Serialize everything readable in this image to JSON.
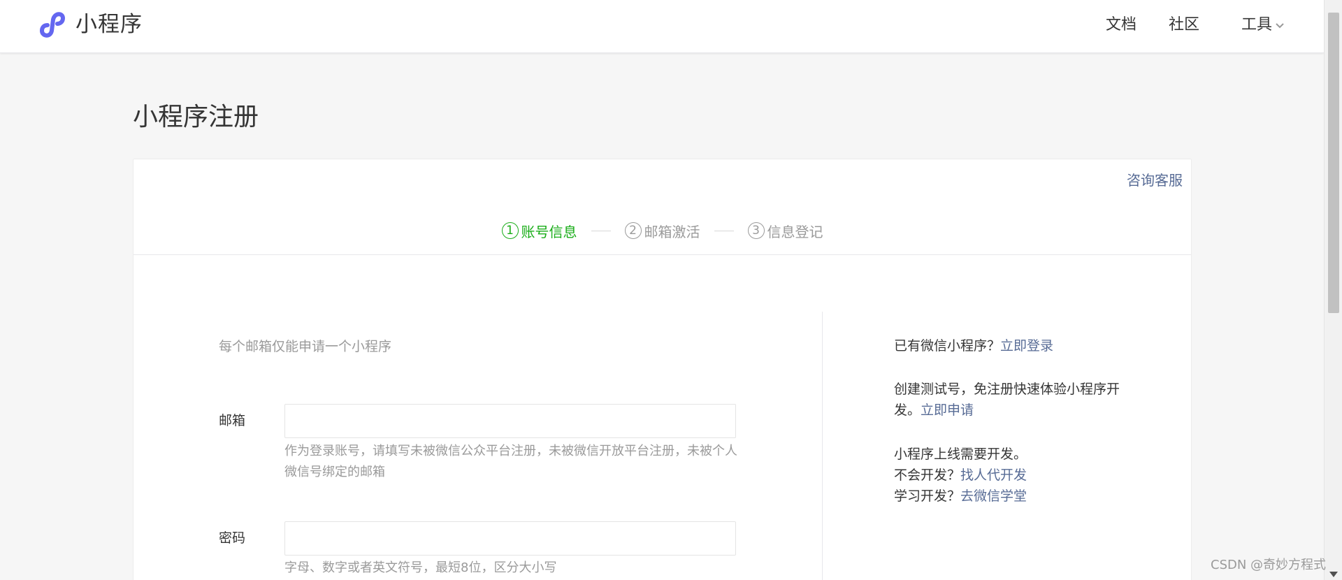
{
  "header": {
    "brand": "小程序",
    "nav": {
      "docs": "文档",
      "community": "社区",
      "tools": "工具"
    },
    "logo_icon": "mini-program-logo-icon",
    "logo_color": "#6467f0"
  },
  "page": {
    "title": "小程序注册"
  },
  "card": {
    "consult": "咨询客服",
    "steps": [
      {
        "num": "1",
        "label": "账号信息",
        "active": true
      },
      {
        "num": "2",
        "label": "邮箱激活",
        "active": false
      },
      {
        "num": "3",
        "label": "信息登记",
        "active": false
      }
    ],
    "form": {
      "intro": "每个邮箱仅能申请一个小程序",
      "email": {
        "label": "邮箱",
        "value": "",
        "hint": "作为登录账号，请填写未被微信公众平台注册，未被微信开放平台注册，未被个人微信号绑定的邮箱"
      },
      "password": {
        "label": "密码",
        "value": "",
        "hint": "字母、数字或者英文符号，最短8位，区分大小写"
      }
    },
    "side": {
      "login_text": "已有微信小程序？",
      "login_link": "立即登录",
      "test_text": "创建测试号，免注册快速体验小程序开发。",
      "test_link": "立即申请",
      "online_text": "小程序上线需要开发。",
      "no_dev_text": "不会开发？",
      "no_dev_link": "找人代开发",
      "learn_text": "学习开发？",
      "learn_link": "去微信学堂"
    }
  },
  "watermark": "CSDN @奇妙方程式",
  "colors": {
    "active_step": "#1aad19",
    "link": "#576b95",
    "muted": "#9a9a9a"
  }
}
